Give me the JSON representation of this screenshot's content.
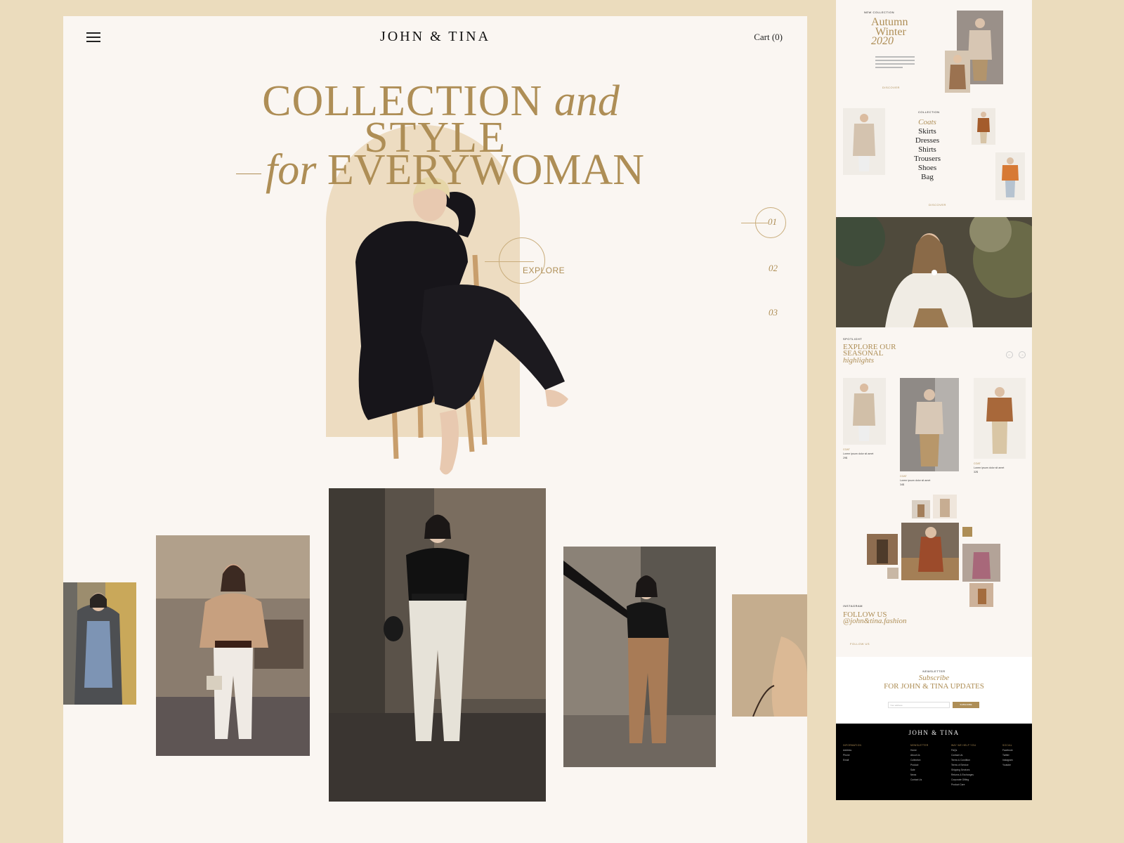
{
  "header": {
    "logo": "JOHN & TINA",
    "cart": "Cart (0)"
  },
  "hero": {
    "line1_caps": "COLLECTION",
    "line1_italic": "and",
    "line2": "STYLE",
    "line3_italic": "for",
    "line3_caps": "EVERYWOMAN",
    "explore": "EXPLORE",
    "slides": [
      "01",
      "02",
      "03"
    ]
  },
  "gallery": {
    "photos": [
      "photo-denim-dress",
      "photo-camel-sweater",
      "photo-black-top-white-pants",
      "photo-brown-trousers",
      "photo-camel-coat-closeup"
    ]
  },
  "preview": {
    "new_collection": {
      "tag": "NEW COLLECTION",
      "title_line1": "Autumn",
      "title_line2": "Winter",
      "title_line3": "2020",
      "cta": "DISCOVER"
    },
    "collection": {
      "tag": "COLLECTION",
      "items": [
        "Coats",
        "Skirts",
        "Dresses",
        "Shirts",
        "Trousers",
        "Shoes",
        "Bag"
      ],
      "cta": "DISCOVER"
    },
    "spotlight": {
      "tag": "SPOTLIGHT",
      "title_line1": "EXPLORE OUR",
      "title_line2": "SEASONAL",
      "title_italic": "highlights",
      "prev": "←",
      "next": "→",
      "products": [
        {
          "category": "COAT",
          "name": "Lorem ipsum dolor sit amet",
          "price": "29$"
        },
        {
          "category": "COAT",
          "name": "Lorem ipsum dolor sit amet",
          "price": "34$"
        },
        {
          "category": "COAT",
          "name": "Lorem ipsum dolor sit amet",
          "price": "32$"
        }
      ]
    },
    "instagram": {
      "tag": "INSTAGRAM",
      "title": "FOLLOW US",
      "handle": "@john&tina.fashion",
      "cta": "FOLLOW US"
    },
    "newsletter": {
      "tag": "NEWSLETTER",
      "title_italic": "Subscribe",
      "title": "FOR JOHN & TINA UPDATES",
      "placeholder": "Your address",
      "button": "SUBSCRIBE"
    },
    "footer": {
      "logo": "JOHN & TINA",
      "columns": [
        {
          "heading": "INFORMATION",
          "items": [
            "Address",
            "Phone",
            "Email"
          ]
        },
        {
          "heading": "NEWSLETTER",
          "items": [
            "Home",
            "About Us",
            "Collection",
            "Product",
            "Sale",
            "News",
            "Contact Us"
          ]
        },
        {
          "heading": "WAY WE HELP YOU",
          "items": [
            "FAQs",
            "Contact Us",
            "Terms & Condition",
            "Terms of Service",
            "Shipping Services",
            "Returns & Exchanges",
            "Corporate Gifting",
            "Product Care"
          ]
        },
        {
          "heading": "SOCIAL",
          "items": [
            "Facebook",
            "Twitter",
            "Instagram",
            "Youtube"
          ]
        }
      ]
    }
  },
  "colors": {
    "gold": "#ae8e56",
    "page_bg": "#ebdcbd",
    "card_bg": "#faf6f2",
    "arch": "#eddcc1"
  }
}
